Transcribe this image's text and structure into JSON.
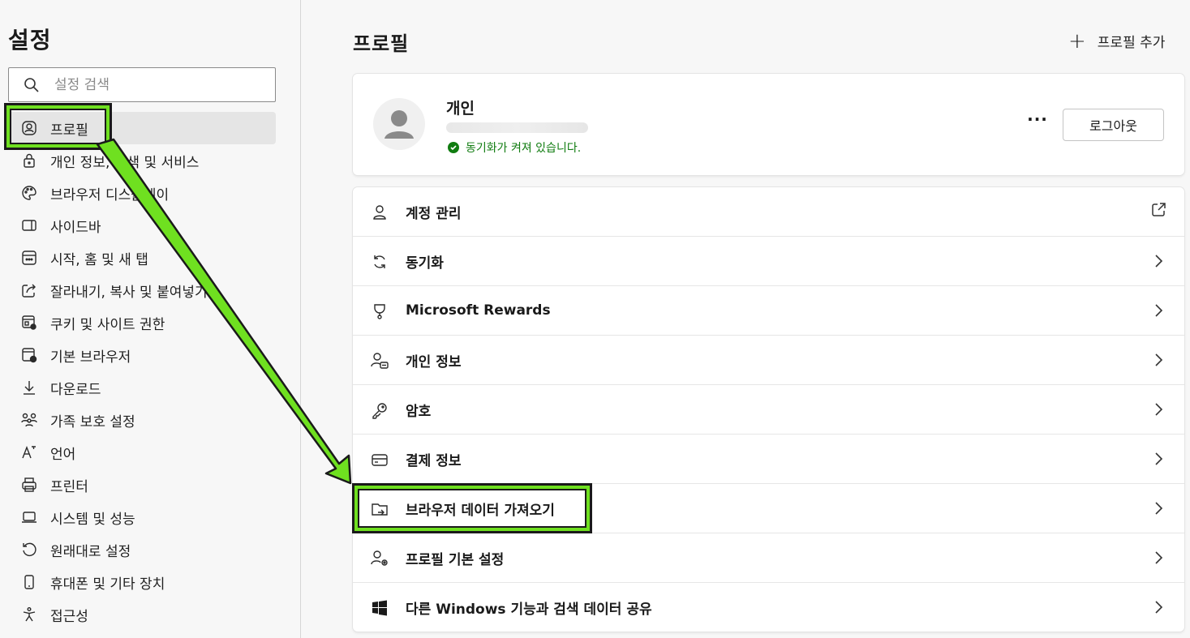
{
  "sidebar": {
    "title": "설정",
    "search_placeholder": "설정 검색",
    "items": [
      {
        "label": "프로필",
        "icon": "profile-icon"
      },
      {
        "label": "개인 정보, 검색 및 서비스",
        "icon": "lock-icon"
      },
      {
        "label": "브라우저 디스플레이",
        "icon": "palette-icon"
      },
      {
        "label": "사이드바",
        "icon": "sidebar-icon"
      },
      {
        "label": "시작, 홈 및 새 탭",
        "icon": "home-grid-icon"
      },
      {
        "label": "잘라내기, 복사 및 붙여넣기",
        "icon": "share-icon"
      },
      {
        "label": "쿠키 및 사이트 권한",
        "icon": "cookie-site-icon"
      },
      {
        "label": "기본 브라우저",
        "icon": "browser-icon"
      },
      {
        "label": "다운로드",
        "icon": "download-icon"
      },
      {
        "label": "가족 보호 설정",
        "icon": "family-icon"
      },
      {
        "label": "언어",
        "icon": "language-icon"
      },
      {
        "label": "프린터",
        "icon": "printer-icon"
      },
      {
        "label": "시스템 및 성능",
        "icon": "laptop-icon"
      },
      {
        "label": "원래대로 설정",
        "icon": "reset-icon"
      },
      {
        "label": "휴대폰 및 기타 장치",
        "icon": "phone-icon"
      },
      {
        "label": "접근성",
        "icon": "accessibility-icon"
      }
    ]
  },
  "main": {
    "title": "프로필",
    "add_profile": "프로필 추가",
    "profile": {
      "name": "개인",
      "sync_status": "동기화가 켜져 있습니다.",
      "more": "···",
      "logout": "로그아웃"
    },
    "rows": [
      {
        "label": "계정 관리",
        "icon": "account-icon",
        "action": "external-link-icon"
      },
      {
        "label": "동기화",
        "icon": "sync-icon",
        "action": "chevron-right-icon"
      },
      {
        "label": "Microsoft Rewards",
        "icon": "rewards-trophy-icon",
        "action": "chevron-right-icon"
      },
      {
        "label": "개인 정보",
        "icon": "personal-info-icon",
        "action": "chevron-right-icon"
      },
      {
        "label": "암호",
        "icon": "key-icon",
        "action": "chevron-right-icon"
      },
      {
        "label": "결제 정보",
        "icon": "card-icon",
        "action": "chevron-right-icon"
      },
      {
        "label": "브라우저 데이터 가져오기",
        "icon": "import-folder-icon",
        "action": "chevron-right-icon"
      },
      {
        "label": "프로필 기본 설정",
        "icon": "profile-settings-icon",
        "action": "chevron-right-icon"
      },
      {
        "label": "다른 Windows 기능과 검색 데이터 공유",
        "icon": "windows-icon",
        "action": "chevron-right-icon"
      }
    ]
  },
  "annotation": {
    "color": "#6fe020",
    "highlight_targets": [
      "sidebar-item-profile",
      "row-import-browser-data"
    ]
  }
}
